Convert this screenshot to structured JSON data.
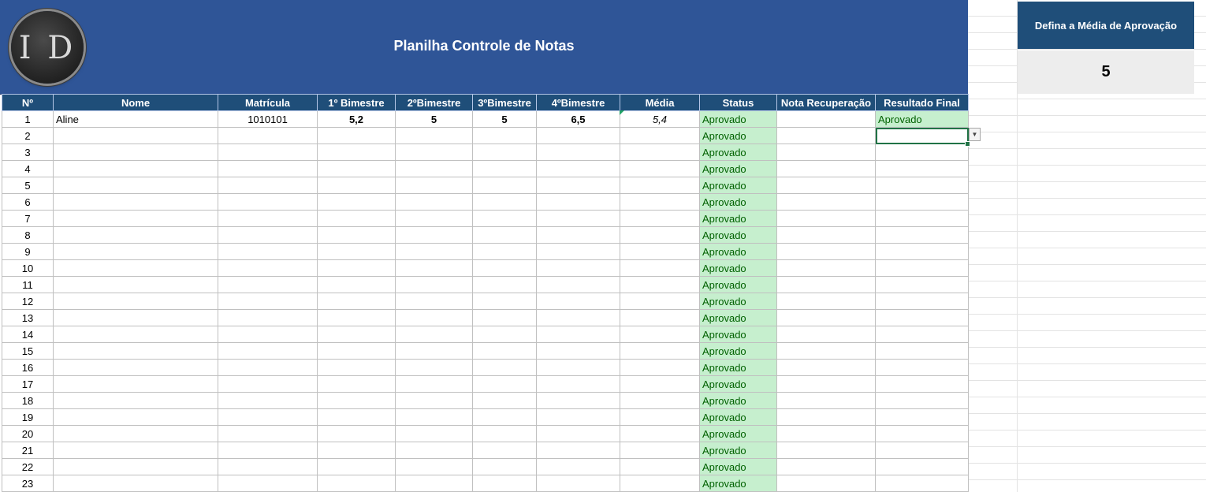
{
  "sheet": {
    "title": "Planilha Controle de Notas",
    "logo_text": "I D"
  },
  "columns": [
    "Nº",
    "Nome",
    "Matrícula",
    "1º Bimestre",
    "2ºBimestre",
    "3ºBimestre",
    "4ºBimestre",
    "Média",
    "Status",
    "Nota Recuperação",
    "Resultado Final"
  ],
  "rows": [
    {
      "n": "1",
      "nome": "Aline",
      "matricula": "1010101",
      "b1": "5,2",
      "b2": "5",
      "b3": "5",
      "b4": "6,5",
      "media": "5,4",
      "status": "Aprovado",
      "recuperacao": "",
      "resultado": "Aprovado"
    },
    {
      "n": "2",
      "status": "Aprovado"
    },
    {
      "n": "3",
      "status": "Aprovado"
    },
    {
      "n": "4",
      "status": "Aprovado"
    },
    {
      "n": "5",
      "status": "Aprovado"
    },
    {
      "n": "6",
      "status": "Aprovado"
    },
    {
      "n": "7",
      "status": "Aprovado"
    },
    {
      "n": "8",
      "status": "Aprovado"
    },
    {
      "n": "9",
      "status": "Aprovado"
    },
    {
      "n": "10",
      "status": "Aprovado"
    },
    {
      "n": "11",
      "status": "Aprovado"
    },
    {
      "n": "12",
      "status": "Aprovado"
    },
    {
      "n": "13",
      "status": "Aprovado"
    },
    {
      "n": "14",
      "status": "Aprovado"
    },
    {
      "n": "15",
      "status": "Aprovado"
    },
    {
      "n": "16",
      "status": "Aprovado"
    },
    {
      "n": "17",
      "status": "Aprovado"
    },
    {
      "n": "18",
      "status": "Aprovado"
    },
    {
      "n": "19",
      "status": "Aprovado"
    },
    {
      "n": "20",
      "status": "Aprovado"
    },
    {
      "n": "21",
      "status": "Aprovado"
    },
    {
      "n": "22",
      "status": "Aprovado"
    },
    {
      "n": "23",
      "status": "Aprovado"
    }
  ],
  "approval": {
    "label": "Defina a Média de Aprovação",
    "value": "5"
  },
  "colors": {
    "header_blue": "#2f5597",
    "column_header": "#1f4e79",
    "status_fill": "#c6efce",
    "status_text": "#006100"
  },
  "icons": {
    "dropdown": "chevron-down-icon"
  }
}
